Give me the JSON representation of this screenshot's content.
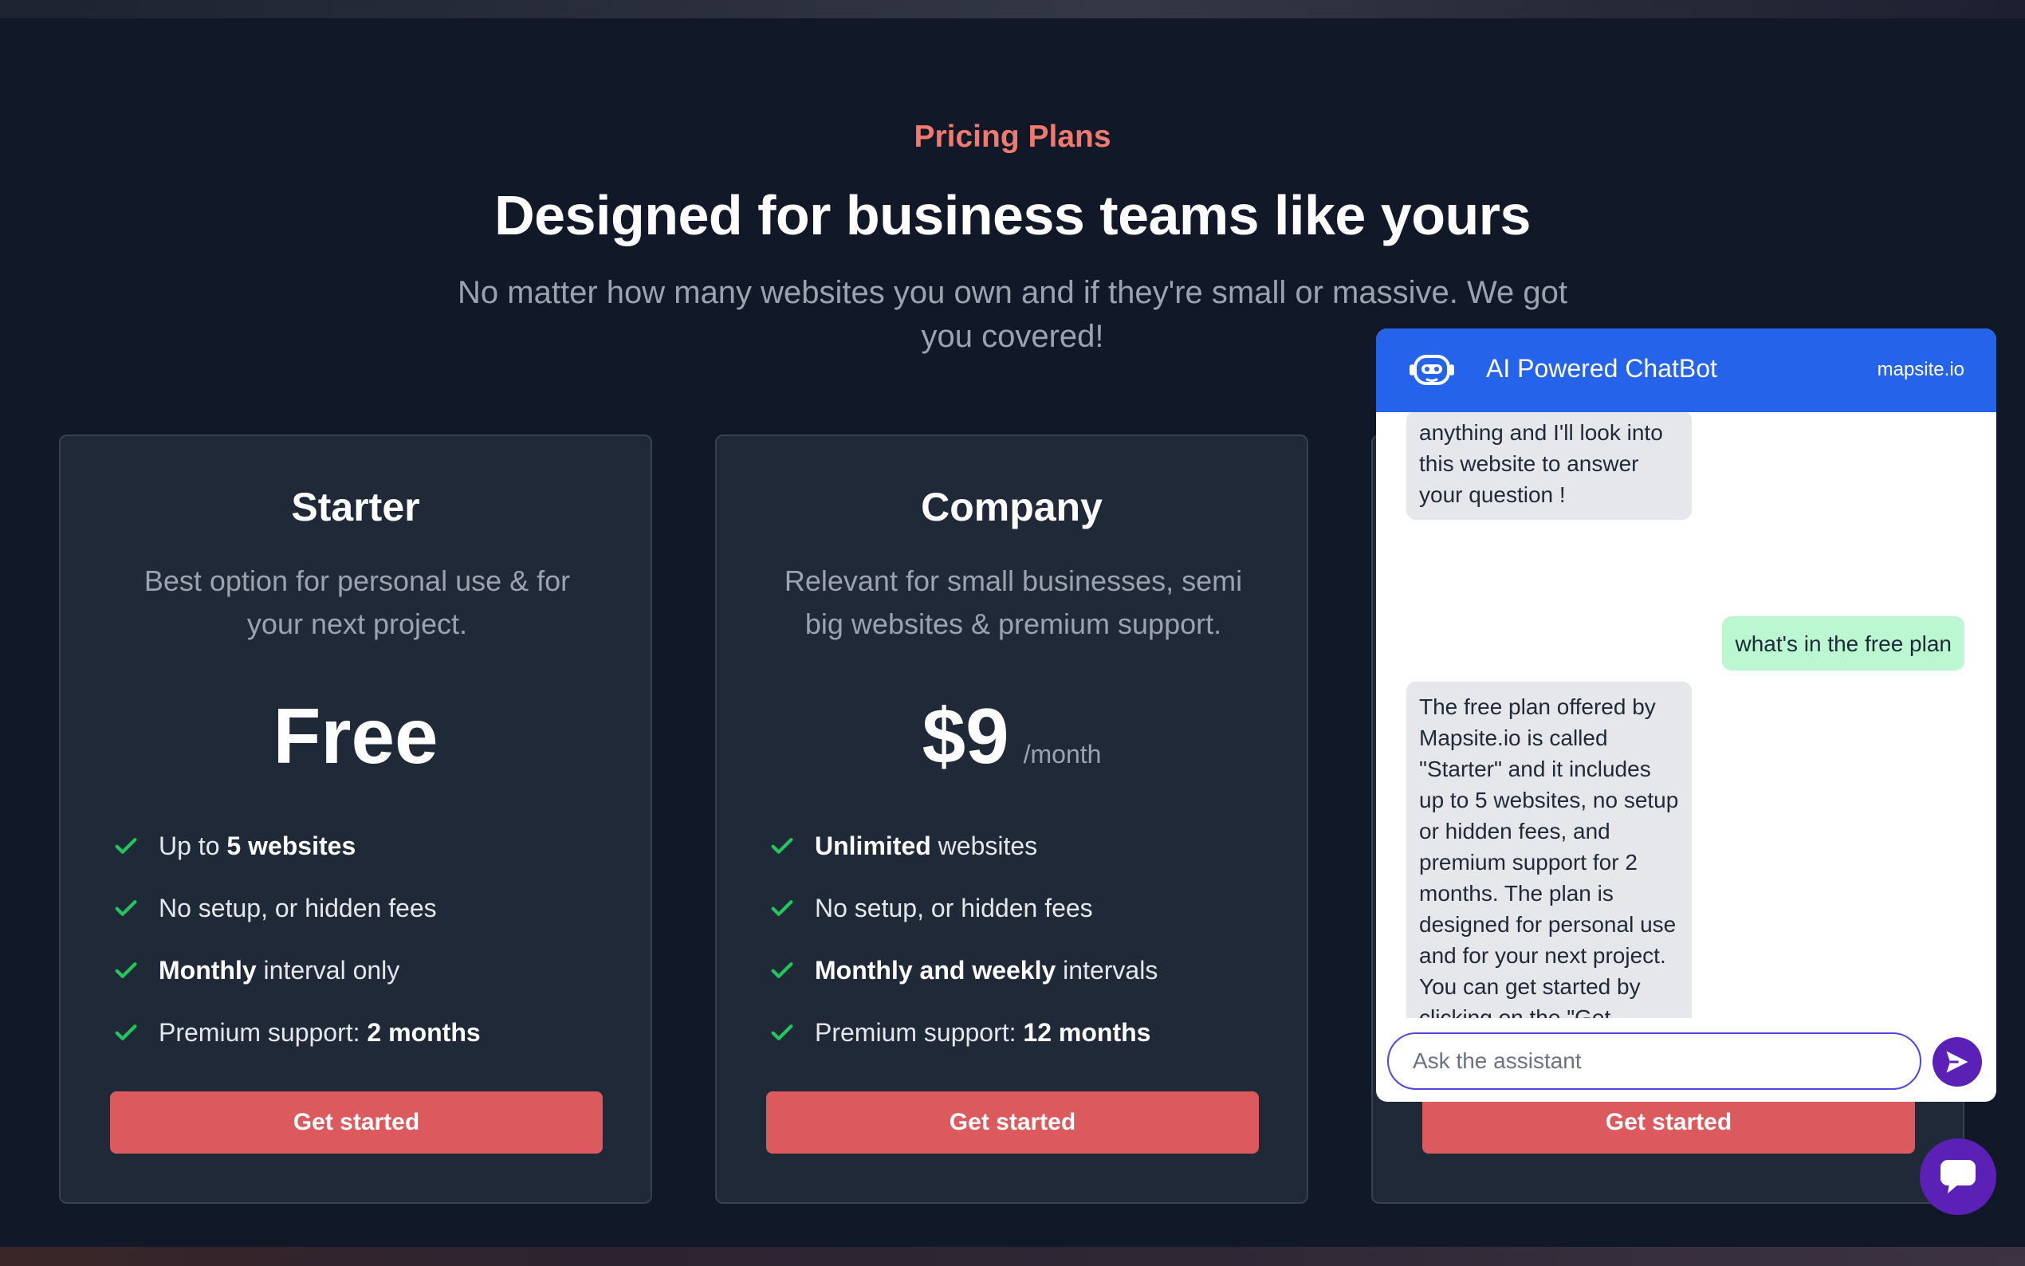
{
  "header": {
    "eyebrow": "Pricing Plans",
    "title": "Designed for business teams like yours",
    "subtitle": "No matter how many websites you own and if they're small or massive. We got you covered!"
  },
  "plans": [
    {
      "name": "Starter",
      "description": "Best option for personal use & for your next project.",
      "price": "Free",
      "period": "",
      "features": [
        {
          "pre": "Up to ",
          "bold": "5 websites",
          "post": ""
        },
        {
          "pre": "No setup, or hidden fees",
          "bold": "",
          "post": ""
        },
        {
          "pre": "",
          "bold": "Monthly",
          "post": " interval only"
        },
        {
          "pre": "Premium support: ",
          "bold": "2 months",
          "post": ""
        }
      ],
      "cta": "Get started"
    },
    {
      "name": "Company",
      "description": "Relevant for small businesses, semi big websites & premium support.",
      "price": "$9",
      "period": "/month",
      "features": [
        {
          "pre": "",
          "bold": "Unlimited",
          "post": " websites"
        },
        {
          "pre": "No setup, or hidden fees",
          "bold": "",
          "post": ""
        },
        {
          "pre": "",
          "bold": "Monthly and weekly",
          "post": " intervals"
        },
        {
          "pre": "Premium support: ",
          "bold": "12 months",
          "post": ""
        }
      ],
      "cta": "Get started"
    },
    {
      "cta": "Get started"
    }
  ],
  "chatbot": {
    "title": "AI Powered ChatBot",
    "site": "mapsite.io",
    "messages": [
      {
        "from": "bot",
        "text": "anything and I'll look into this website to answer your question !"
      },
      {
        "from": "user",
        "text": "what's in the free plan"
      },
      {
        "from": "bot",
        "text": "The free plan offered by Mapsite.io is called \"Starter\" and it includes up to 5 websites, no setup or hidden fees, and premium support for 2 months. The plan is designed for personal use and for your next project. You can get started by clicking on the \"Get started\" button on the pricing page."
      }
    ],
    "input_placeholder": "Ask the assistant",
    "input_value": ""
  },
  "icons": {
    "check": "check-icon",
    "bot": "robot-icon",
    "send": "send-icon",
    "chat_fab": "chat-bubble-icon"
  },
  "colors": {
    "background": "#111827",
    "card": "#1f2937",
    "accent_text": "#f17a6f",
    "cta": "#dc5a5e",
    "check": "#22c55e",
    "chat_header": "#2563eb",
    "user_bubble": "#bbf7d0",
    "bot_bubble": "#e5e7eb",
    "fab": "#5b21b6"
  }
}
